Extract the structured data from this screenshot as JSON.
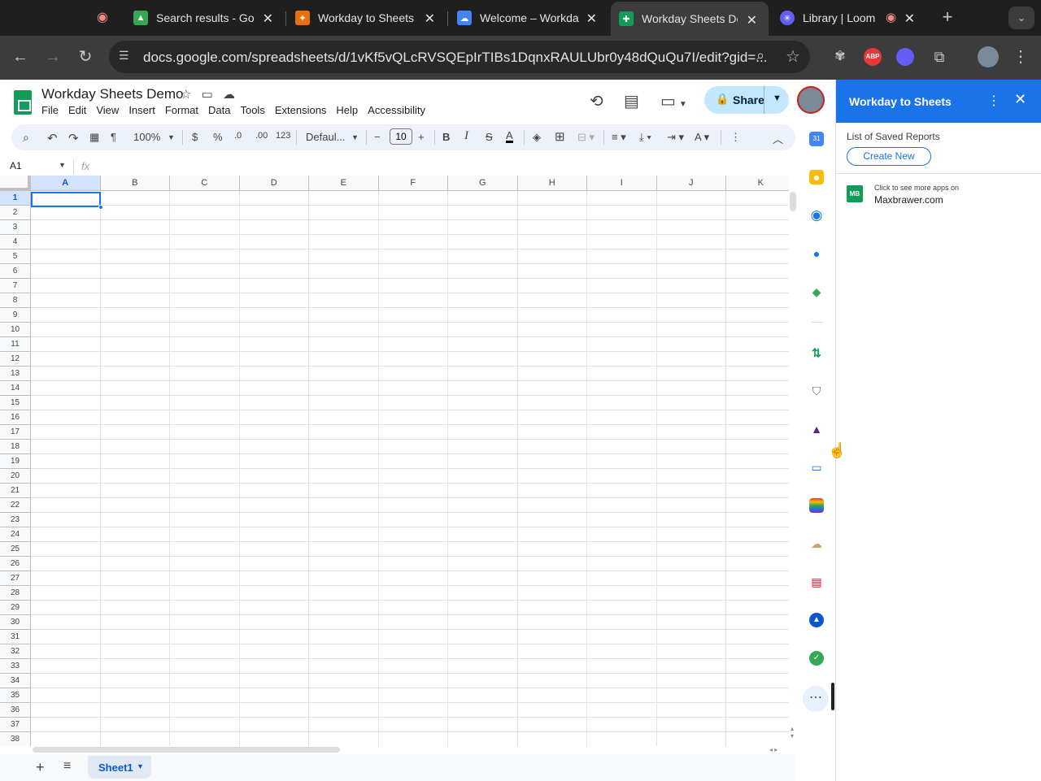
{
  "browser": {
    "tabs": [
      {
        "title": "Search results - Go",
        "favicon_color": "#34a853"
      },
      {
        "title": "Workday to Sheets",
        "favicon_color": "#e8710a"
      },
      {
        "title": "Welcome – Workday",
        "favicon_color": "#4285f4"
      },
      {
        "title": "Workday Sheets De",
        "favicon_color": "#0f9d58"
      },
      {
        "title": "Library | Loom",
        "favicon_color": "#625df5"
      }
    ],
    "new_tab_label": "+",
    "url": "docs.google.com/spreadsheets/d/1vKf5vQLcRVSQEpIrTIBs1DqnxRAULUbr0y48dQuQu7I/edit?gid=...",
    "extension_abp": "ABP"
  },
  "sheets": {
    "doc_title": "Workday Sheets Demo",
    "menu": [
      "File",
      "Edit",
      "View",
      "Insert",
      "Format",
      "Data",
      "Tools",
      "Extensions",
      "Help",
      "Accessibility"
    ],
    "share_label": "Share",
    "toolbar": {
      "zoom": "100%",
      "currency": "$",
      "percent": "%",
      "dec_decrease": ".0",
      "dec_increase": ".00",
      "number_format": "123",
      "font": "Defaul...",
      "font_size": "10",
      "bold": "B",
      "italic": "I",
      "strike": "S",
      "text_color": "A"
    },
    "name_box": "A1",
    "fx_label": "fx",
    "columns": [
      "A",
      "B",
      "C",
      "D",
      "E",
      "F",
      "G",
      "H",
      "I",
      "J",
      "K"
    ],
    "rows": [
      "1",
      "2",
      "3",
      "4",
      "5",
      "6",
      "7",
      "8",
      "9",
      "10",
      "11",
      "12",
      "13",
      "14",
      "15",
      "16",
      "17",
      "18",
      "19",
      "20",
      "21",
      "22",
      "23",
      "24",
      "25",
      "26",
      "27",
      "28",
      "29",
      "30",
      "31",
      "32",
      "33",
      "34",
      "35",
      "36",
      "37",
      "38"
    ],
    "selected_cell": "A1",
    "sheet_tab": "Sheet1"
  },
  "panel": {
    "title": "Workday to Sheets",
    "subtitle": "List of Saved Reports",
    "create_button": "Create New",
    "promo_small": "Click to see more apps on",
    "promo_link": "Maxbrawer.com",
    "logo_text": "MB"
  },
  "colors": {
    "accent": "#1a73e8",
    "share_bg": "#c2e7ff",
    "sheets_green": "#0f9d58"
  }
}
